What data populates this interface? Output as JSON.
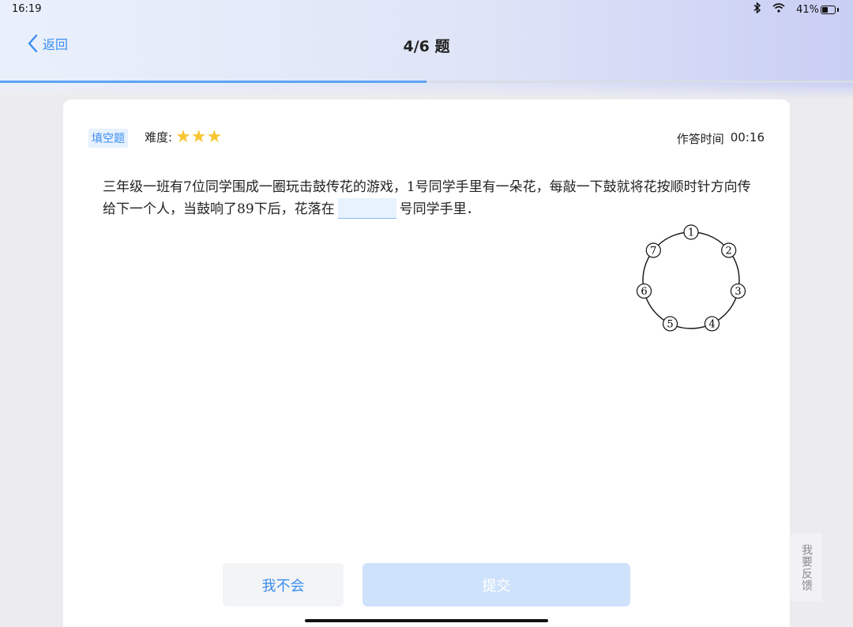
{
  "status_bar": {
    "time": "16:19",
    "battery": "41%",
    "battery_level": 0.41
  },
  "nav": {
    "back_label": "返回",
    "title": "4/6 题",
    "progress": 0.5
  },
  "question_header": {
    "type_badge": "填空题",
    "difficulty_label": "难度:",
    "stars": 3,
    "timer_label": "作答时间",
    "timer_value": "00:16"
  },
  "question": {
    "text_before": "三年级一班有7位同学围成一圈玩击鼓传花的游戏，1号同学手里有一朵花，每敲一下鼓就将花按顺时针方向传给下一个人，当鼓响了89下后，花落在",
    "text_after": "号同学手里．",
    "blank_value": ""
  },
  "diagram": {
    "nodes": [
      "1",
      "2",
      "3",
      "4",
      "5",
      "6",
      "7"
    ]
  },
  "actions": {
    "unknown_label": "我不会",
    "submit_label": "提交"
  },
  "feedback_label": "我要反馈",
  "colors": {
    "accent": "#3a8df0",
    "star": "#f7c531",
    "submit_disabled": "#cfe2fb"
  }
}
